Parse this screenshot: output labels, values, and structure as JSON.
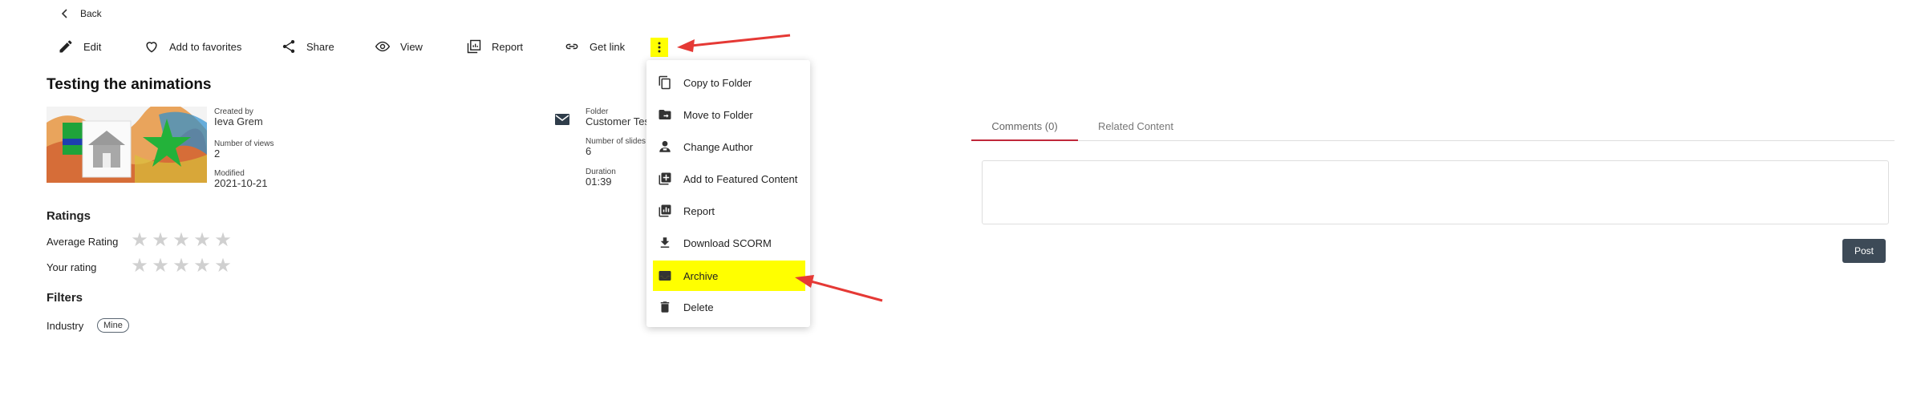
{
  "nav": {
    "back_label": "Back"
  },
  "toolbar": {
    "edit_label": "Edit",
    "favorites_label": "Add to favorites",
    "share_label": "Share",
    "view_label": "View",
    "report_label": "Report",
    "get_link_label": "Get link",
    "more_icon": "more-vertical-icon"
  },
  "content": {
    "title": "Testing the animations",
    "created_by_label": "Created by",
    "created_by_value": "Ieva Grem",
    "views_label": "Number of views",
    "views_value": "2",
    "modified_label": "Modified",
    "modified_value": "2021-10-21",
    "folder_label": "Folder",
    "folder_value": "Customer Test",
    "slides_label": "Number of slides",
    "slides_value": "6",
    "duration_label": "Duration",
    "duration_value": "01:39"
  },
  "ratings": {
    "heading": "Ratings",
    "average_label": "Average Rating",
    "your_label": "Your rating",
    "average_value": 0,
    "your_value": 0,
    "max": 5
  },
  "filters": {
    "heading": "Filters",
    "industry_label": "Industry",
    "industry_tag": "Mine"
  },
  "menu": {
    "items": [
      {
        "label": "Copy to Folder",
        "icon": "copy-icon"
      },
      {
        "label": "Move to Folder",
        "icon": "folder-move-icon"
      },
      {
        "label": "Change Author",
        "icon": "person-icon"
      },
      {
        "label": "Add to Featured Content",
        "icon": "add-box-icon"
      },
      {
        "label": "Report",
        "icon": "report-icon"
      },
      {
        "label": "Download SCORM",
        "icon": "download-icon"
      },
      {
        "label": "Archive",
        "icon": "archive-icon",
        "highlighted": true
      },
      {
        "label": "Delete",
        "icon": "trash-icon"
      }
    ]
  },
  "tabs": [
    {
      "label": "Comments (0)",
      "active": true
    },
    {
      "label": "Related Content",
      "active": false
    }
  ],
  "comments": {
    "post_label": "Post"
  },
  "colors": {
    "highlight": "#ffff00",
    "accent_red": "#c0283a",
    "arrow_red": "#e53935",
    "post_button": "#3d4a57"
  }
}
